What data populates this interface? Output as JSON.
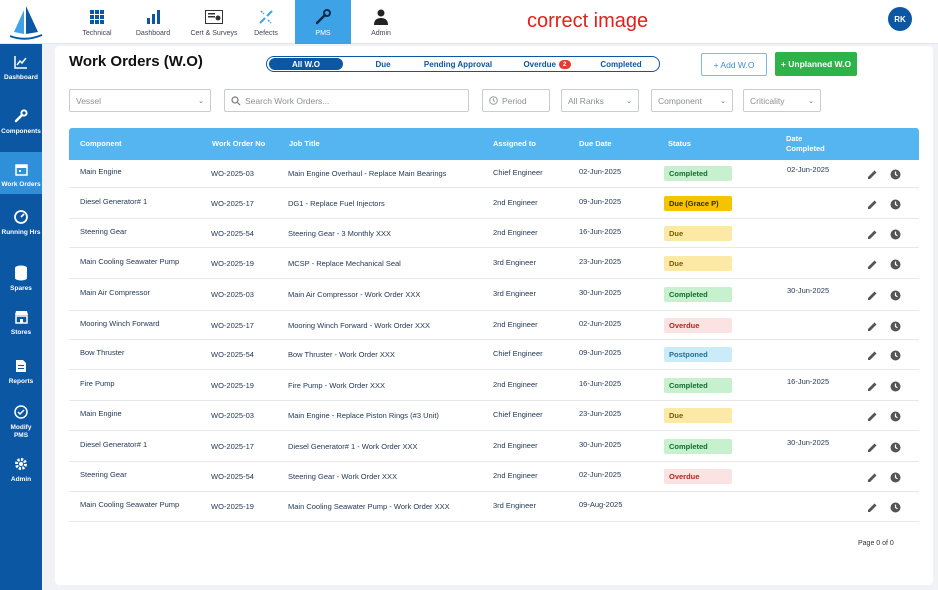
{
  "topnav": {
    "items": [
      {
        "label": "Technical",
        "icon": "grid-icon"
      },
      {
        "label": "Dashboard",
        "icon": "bar-chart-icon"
      },
      {
        "label": "Cert & Surveys",
        "icon": "certificate-icon"
      },
      {
        "label": "Defects",
        "icon": "broken-tool-icon"
      },
      {
        "label": "PMS",
        "icon": "wrench-icon"
      },
      {
        "label": "Admin",
        "icon": "admin-user-icon"
      }
    ],
    "active": "PMS",
    "overlay_text": "correct image",
    "avatar_initials": "RK"
  },
  "sidebar": {
    "items": [
      {
        "label": "Dashboard",
        "icon": "trend-chart-icon"
      },
      {
        "label": "Components",
        "icon": "wrench-icon"
      },
      {
        "label": "Work Orders",
        "icon": "calendar-icon"
      },
      {
        "label": "Running Hrs",
        "icon": "gauge-icon"
      },
      {
        "label": "Spares",
        "icon": "database-icon"
      },
      {
        "label": "Stores",
        "icon": "store-icon"
      },
      {
        "label": "Reports",
        "icon": "report-icon"
      },
      {
        "label": "Modify PMS",
        "icon": "modify-icon"
      },
      {
        "label": "Admin",
        "icon": "gear-icon"
      }
    ],
    "active": "Work Orders"
  },
  "page": {
    "title": "Work Orders (W.O)",
    "tabs": [
      {
        "label": "All W.O",
        "active": true
      },
      {
        "label": "Due",
        "active": false
      },
      {
        "label": "Pending Approval",
        "active": false
      },
      {
        "label": "Overdue",
        "badge": "2",
        "active": false
      },
      {
        "label": "Completed",
        "active": false
      }
    ],
    "add_wo_label": "+ Add W.O",
    "add_unplanned_label": "+ Unplanned W.O"
  },
  "filters": {
    "vessel": "Vessel",
    "search_placeholder": "Search Work Orders...",
    "period": "Period",
    "ranks": "All Ranks",
    "component": "Component",
    "criticality": "Criticality"
  },
  "table": {
    "headers": [
      "Component",
      "Work Order No",
      "Job Title",
      "Assigned to",
      "Due Date",
      "Status",
      "Date Completed"
    ],
    "rows": [
      {
        "component": "Main Engine",
        "wo": "WO-2025-03",
        "job": "Main Engine Overhaul - Replace Main Bearings",
        "assigned": "Chief Engineer",
        "due": "02-Jun-2025",
        "status": "Completed",
        "completed": "02-Jun-2025"
      },
      {
        "component": "Diesel Generator# 1",
        "wo": "WO-2025-17",
        "job": "DG1 - Replace Fuel Injectors",
        "assigned": "2nd Engineer",
        "due": "09-Jun-2025",
        "status": "Due (Grace P)",
        "completed": ""
      },
      {
        "component": "Steering Gear",
        "wo": "WO-2025-54",
        "job": "Steering Gear - 3 Monthly XXX",
        "assigned": "2nd Engineer",
        "due": "16-Jun-2025",
        "status": "Due",
        "completed": ""
      },
      {
        "component": "Main Cooling Seawater Pump",
        "wo": "WO-2025-19",
        "job": "MCSP - Replace Mechanical Seal",
        "assigned": "3rd Engineer",
        "due": "23-Jun-2025",
        "status": "Due",
        "completed": ""
      },
      {
        "component": "Main Air Compressor",
        "wo": "WO-2025-03",
        "job": "Main Air Compressor - Work Order XXX",
        "assigned": "3rd Engineer",
        "due": "30-Jun-2025",
        "status": "Completed",
        "completed": "30-Jun-2025"
      },
      {
        "component": "Mooring Winch Forward",
        "wo": "WO-2025-17",
        "job": "Mooring Winch Forward - Work Order XXX",
        "assigned": "2nd Engineer",
        "due": "02-Jun-2025",
        "status": "Overdue",
        "completed": ""
      },
      {
        "component": "Bow Thruster",
        "wo": "WO-2025-54",
        "job": "Bow Thruster - Work Order XXX",
        "assigned": "Chief Engineer",
        "due": "09-Jun-2025",
        "status": "Postponed",
        "completed": ""
      },
      {
        "component": "Fire Pump",
        "wo": "WO-2025-19",
        "job": "Fire Pump - Work Order XXX",
        "assigned": "2nd Engineer",
        "due": "16-Jun-2025",
        "status": "Completed",
        "completed": "16-Jun-2025"
      },
      {
        "component": "Main Engine",
        "wo": "WO-2025-03",
        "job": "Main Engine - Replace Piston Rings (#3 Unit)",
        "assigned": "Chief Engineer",
        "due": "23-Jun-2025",
        "status": "Due",
        "completed": ""
      },
      {
        "component": "Diesel Generator# 1",
        "wo": "WO-2025-17",
        "job": "Diesel Generator# 1 - Work Order XXX",
        "assigned": "2nd Engineer",
        "due": "30-Jun-2025",
        "status": "Completed",
        "completed": "30-Jun-2025"
      },
      {
        "component": "Steering Gear",
        "wo": "WO-2025-54",
        "job": "Steering Gear - Work Order XXX",
        "assigned": "2nd Engineer",
        "due": "02-Jun-2025",
        "status": "Overdue",
        "completed": ""
      },
      {
        "component": "Main Cooling Seawater Pump",
        "wo": "WO-2025-19",
        "job": "Main Cooling Seawater Pump - Work Order XXX",
        "assigned": "3rd Engineer",
        "due": "09-Aug-2025",
        "status": "",
        "completed": ""
      }
    ]
  },
  "pager": "Page 0 of 0"
}
